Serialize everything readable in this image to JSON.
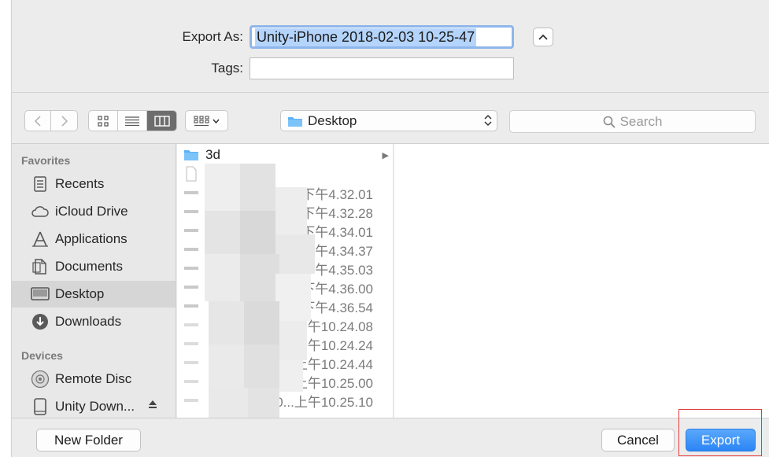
{
  "export_as": {
    "label": "Export As:",
    "value": "Unity-iPhone 2018-02-03 10-25-47"
  },
  "tags": {
    "label": "Tags:",
    "value": ""
  },
  "toolbar": {
    "location": "Desktop",
    "search_placeholder": "Search",
    "active_view": "column"
  },
  "sidebar": {
    "favorites_header": "Favorites",
    "favorites": [
      {
        "label": "Recents",
        "icon": "recents-icon"
      },
      {
        "label": "iCloud Drive",
        "icon": "cloud-icon"
      },
      {
        "label": "Applications",
        "icon": "applications-icon"
      },
      {
        "label": "Documents",
        "icon": "documents-icon"
      },
      {
        "label": "Desktop",
        "icon": "desktop-icon",
        "selected": true
      },
      {
        "label": "Downloads",
        "icon": "downloads-icon"
      }
    ],
    "devices_header": "Devices",
    "devices": [
      {
        "label": "Remote Disc",
        "icon": "disc-icon"
      },
      {
        "label": "Unity Down...",
        "icon": "drive-icon",
        "ejectable": true
      }
    ]
  },
  "files": [
    {
      "name": "3d",
      "kind": "folder"
    },
    {
      "name": "",
      "kind": "file"
    },
    {
      "name": "2 下午4.32.01",
      "kind": "image"
    },
    {
      "name": "下午4.32.28",
      "kind": "image"
    },
    {
      "name": "下午4.34.01",
      "kind": "image"
    },
    {
      "name": "...2 下午4.34.37",
      "kind": "image"
    },
    {
      "name": "0...2 下午4.35.03",
      "kind": "image"
    },
    {
      "name": "下午4.36.00",
      "kind": "image"
    },
    {
      "name": "下午4.36.54",
      "kind": "image"
    },
    {
      "name": "上午10.24.08",
      "kind": "image"
    },
    {
      "name": "...上午10.24.24",
      "kind": "image"
    },
    {
      "name": "...上午10.24.44",
      "kind": "image"
    },
    {
      "name": "...上午10.25.00",
      "kind": "image"
    },
    {
      "name": "20...上午10.25.10",
      "kind": "image"
    }
  ],
  "buttons": {
    "new_folder": "New Folder",
    "cancel": "Cancel",
    "export": "Export"
  },
  "colors": {
    "accent": "#2b85f5",
    "selection": "#b4d4fb",
    "annotation": "#e33b3b"
  }
}
